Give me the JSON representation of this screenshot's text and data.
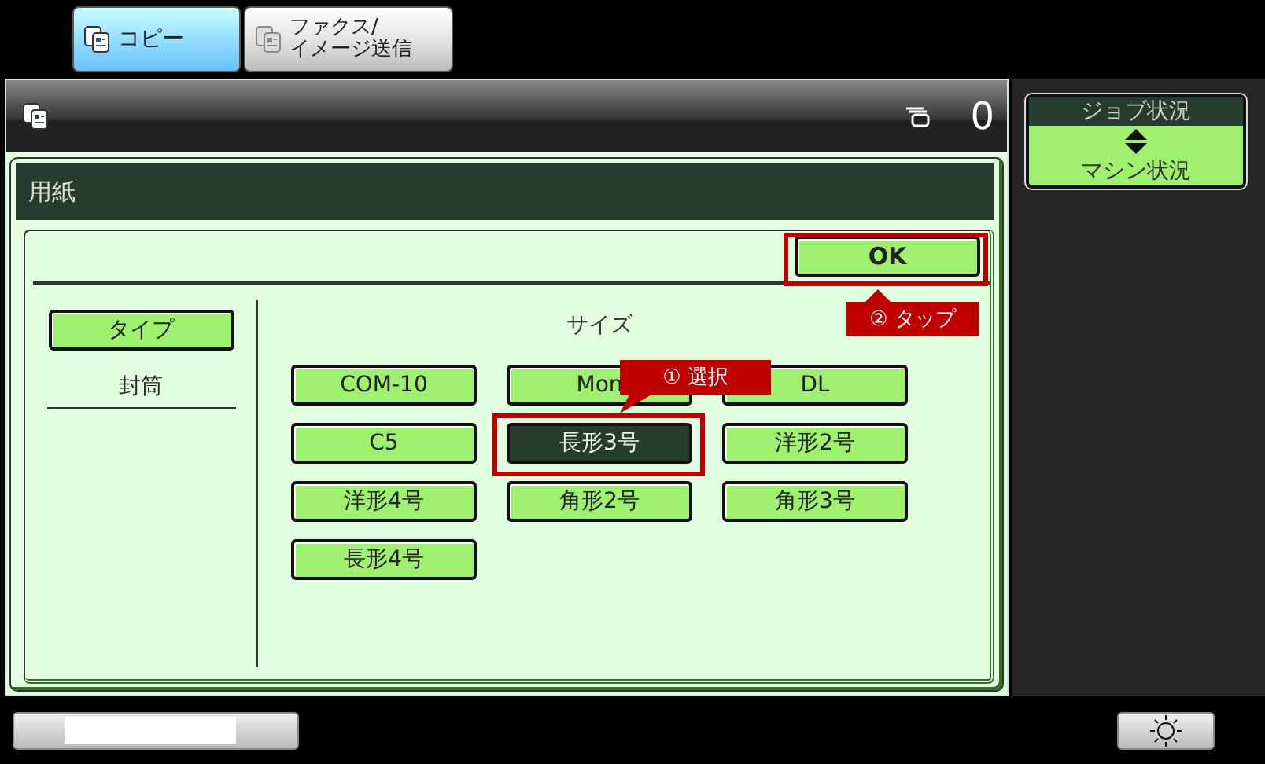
{
  "tabs": [
    {
      "label": "コピー",
      "selected": true
    },
    {
      "label": "ファクス/\nイメージ送信",
      "selected": false
    }
  ],
  "header": {
    "count": "0"
  },
  "dialog": {
    "title": "用紙",
    "ok_button": "OK",
    "ok_callout": {
      "text": "② タップ",
      "kind": "up"
    },
    "type_button": "タイプ",
    "type_value": "封筒",
    "size_title": "サイズ",
    "sizes": [
      {
        "label": "COM-10",
        "selected": false
      },
      {
        "label": "Mon",
        "selected": false
      },
      {
        "label": "DL",
        "selected": false
      },
      {
        "label": "C5",
        "selected": false
      },
      {
        "label": "長形3号",
        "selected": true,
        "callout": {
          "text": "① 選択",
          "kind": "down"
        }
      },
      {
        "label": "洋形2号",
        "selected": false
      },
      {
        "label": "洋形4号",
        "selected": false
      },
      {
        "label": "角形2号",
        "selected": false
      },
      {
        "label": "角形3号",
        "selected": false
      },
      {
        "label": "長形4号",
        "selected": false
      }
    ]
  },
  "side": {
    "top_label": "ジョブ状況",
    "bottom_label": "マシン状況"
  }
}
